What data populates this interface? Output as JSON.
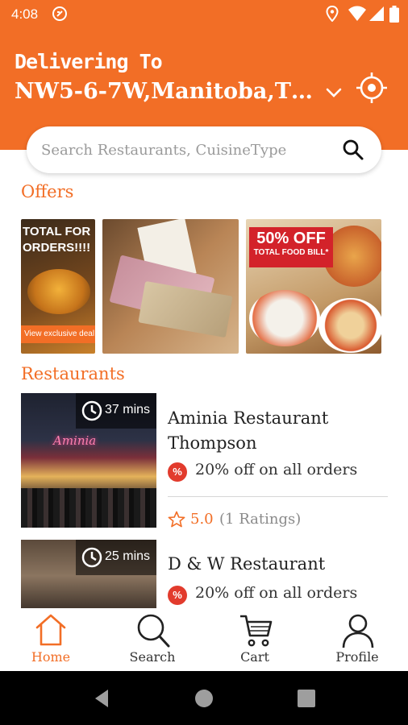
{
  "status_bar": {
    "time": "4:08",
    "icons": [
      "app-notification-icon",
      "location-icon",
      "wifi-icon",
      "signal-icon",
      "battery-icon"
    ]
  },
  "header": {
    "label": "Delivering To",
    "address": "NW5-6-7W,Manitoba,Th...",
    "icons": [
      "chevron-down-icon",
      "gps-target-icon"
    ]
  },
  "search": {
    "placeholder": "Search Restaurants, CuisineType"
  },
  "offers": {
    "title": "Offers",
    "banners": [
      {
        "headline": "TOTAL FOR\nORDERS!!!!",
        "cta": "View exclusive deal"
      },
      {
        "headline": ""
      },
      {
        "headline": "50% OFF",
        "subline": "TOTAL FOOD BILL*"
      }
    ]
  },
  "restaurants": {
    "title": "Restaurants",
    "items": [
      {
        "name": "Aminia Restaurant Thompson",
        "delivery_time": "37 mins",
        "offer": "20% off on all orders",
        "offer_badge": "%",
        "rating": "5.0",
        "ratings_count": "(1 Ratings)",
        "sign_text": "Aminia"
      },
      {
        "name": "D & W Restaurant",
        "delivery_time": "25 mins",
        "offer": "20% off on all orders",
        "offer_badge": "%"
      }
    ]
  },
  "bottom_nav": {
    "items": [
      {
        "label": "Home",
        "icon": "home-icon",
        "active": true
      },
      {
        "label": "Search",
        "icon": "search-icon",
        "active": false
      },
      {
        "label": "Cart",
        "icon": "cart-icon",
        "active": false
      },
      {
        "label": "Profile",
        "icon": "profile-icon",
        "active": false
      }
    ]
  },
  "colors": {
    "accent": "#f26e26",
    "discount_badge": "#e23b2d",
    "promo_red": "#d3222a"
  }
}
